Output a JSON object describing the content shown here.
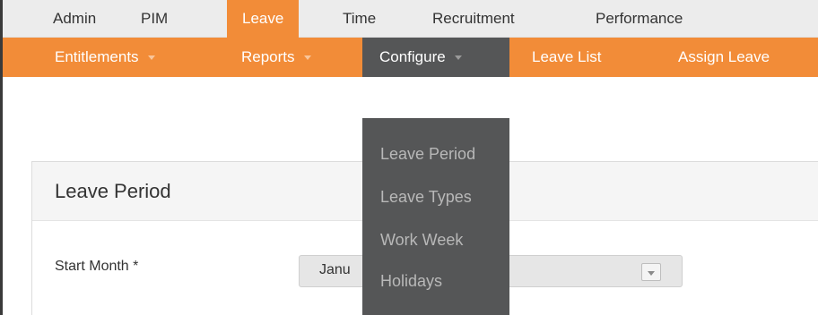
{
  "main_menu": {
    "items": [
      {
        "label": "Admin"
      },
      {
        "label": "PIM"
      },
      {
        "label": "Leave"
      },
      {
        "label": "Time"
      },
      {
        "label": "Recruitment"
      },
      {
        "label": "Performance"
      }
    ],
    "active": "Leave"
  },
  "sub_menu": {
    "items": [
      {
        "label": "Entitlements"
      },
      {
        "label": "Reports"
      },
      {
        "label": "Configure"
      },
      {
        "label": "Leave List"
      },
      {
        "label": "Assign Leave"
      }
    ],
    "open": "Configure"
  },
  "configure_dropdown": {
    "items": [
      {
        "label": "Leave Period"
      },
      {
        "label": "Leave Types"
      },
      {
        "label": "Work Week"
      },
      {
        "label": "Holidays"
      }
    ]
  },
  "panel": {
    "title": "Leave Period",
    "start_month_label": "Start Month",
    "required_marker": "*",
    "start_month_value": "Janu"
  },
  "colors": {
    "accent": "#f28c38",
    "dropdown_bg": "#555657",
    "dropdown_text": "#b8b8b8"
  }
}
